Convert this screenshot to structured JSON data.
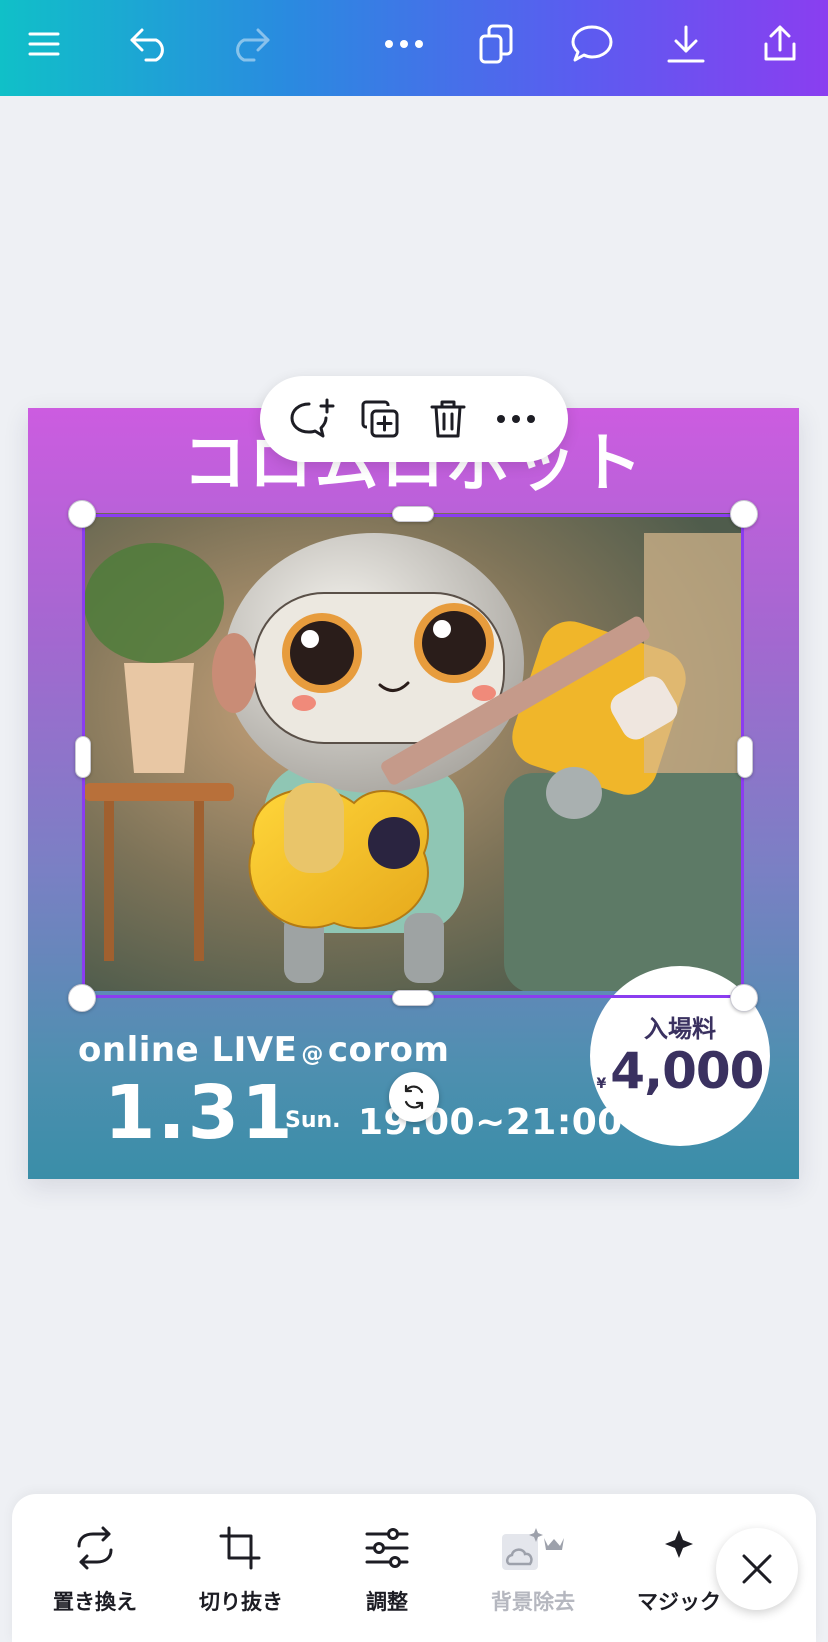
{
  "topbar": {
    "icons": [
      "menu-icon",
      "undo-icon",
      "redo-icon",
      "more-icon",
      "pages-icon",
      "comment-icon",
      "download-icon",
      "share-icon"
    ]
  },
  "design": {
    "title": "コロムロボット",
    "live_text": "online LIVE",
    "at_symbol": "@",
    "venue": "corom",
    "date_big": "1.31",
    "weekday": "Sun.",
    "time": "19:00~21:00",
    "price_label": "入場料",
    "price_currency": "¥",
    "price_value": "4,000"
  },
  "context_toolbar": {
    "icons": [
      "add-comment-icon",
      "duplicate-icon",
      "delete-icon",
      "more-icon"
    ]
  },
  "bottom_toolbar": {
    "items": [
      {
        "label": "置き換え",
        "icon": "replace-icon"
      },
      {
        "label": "切り抜き",
        "icon": "crop-icon"
      },
      {
        "label": "調整",
        "icon": "adjust-icon"
      },
      {
        "label": "背景除去",
        "icon": "background-remover-icon",
        "disabled": true
      },
      {
        "label": "マジック",
        "icon": "magic-icon"
      }
    ]
  },
  "colors": {
    "accent": "#8b3df0",
    "title_text": "#ffffff",
    "price_text": "#3a3160"
  }
}
